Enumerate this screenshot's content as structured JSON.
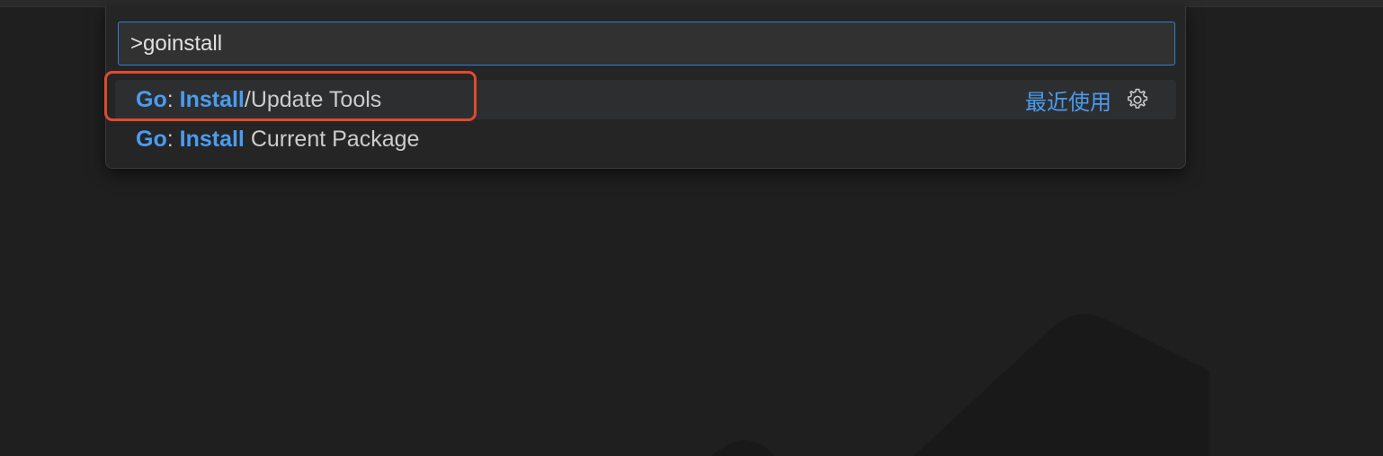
{
  "command_palette": {
    "query": ">goinstall",
    "results": [
      {
        "parts": [
          {
            "text": "Go",
            "highlight": true
          },
          {
            "text": ": ",
            "highlight": false
          },
          {
            "text": "Install",
            "highlight": true
          },
          {
            "text": "/Update Tools",
            "highlight": false
          }
        ],
        "detail_label": "最近使用",
        "detail_icon": "gear-icon"
      },
      {
        "parts": [
          {
            "text": "Go",
            "highlight": true
          },
          {
            "text": ": ",
            "highlight": false
          },
          {
            "text": "Install",
            "highlight": true
          },
          {
            "text": " Current Package",
            "highlight": false
          }
        ]
      }
    ]
  },
  "colors": {
    "background": "#1f1f1f",
    "palette_background": "#252526",
    "input_border": "#2f80d6",
    "highlight": "#4b9cf0",
    "annotation": "#e04a2e"
  }
}
